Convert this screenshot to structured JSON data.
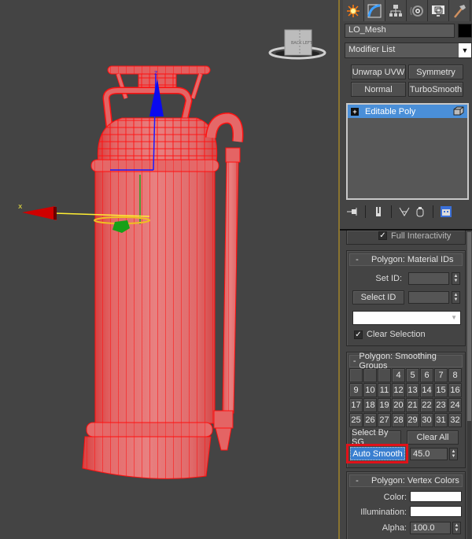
{
  "viewport": {
    "viewcube": {
      "face_front": "BACK",
      "face_side": "LEFT"
    },
    "gizmo": {
      "x_axis_label": "x",
      "z_axis_label": "z"
    },
    "object_color": "#e85050",
    "wire_color": "#ff0000",
    "background_color": "#444444"
  },
  "command_panel": {
    "tabs": [
      {
        "name": "create",
        "icon": "create-icon"
      },
      {
        "name": "modify",
        "icon": "modify-icon",
        "active": true
      },
      {
        "name": "hierarchy",
        "icon": "hierarchy-icon"
      },
      {
        "name": "motion",
        "icon": "motion-icon"
      },
      {
        "name": "display",
        "icon": "display-icon"
      },
      {
        "name": "utilities",
        "icon": "utilities-icon"
      }
    ],
    "object_name": "LO_Mesh",
    "object_color": "#000000",
    "modifier_list": "Modifier List",
    "modifier_buttons": [
      "Unwrap UVW",
      "Symmetry",
      "Normal",
      "TurboSmooth"
    ],
    "stack": [
      {
        "label": "Editable Poly",
        "expand": "+",
        "selected": true
      }
    ],
    "stack_tools": [
      "pin-stack",
      "show-end-result",
      "make-unique",
      "remove-modifier",
      "configure-modifier-sets"
    ],
    "partial_rollout_text": "Full Interactivity",
    "material_ids": {
      "title": "Polygon: Material IDs",
      "collapse": "-",
      "set_id_label": "Set ID:",
      "set_id_value": "",
      "select_id_label": "Select ID",
      "select_id_value": "",
      "name_dropdown_value": "",
      "clear_selection_label": "Clear Selection",
      "clear_selection_checked": true
    },
    "smoothing_groups": {
      "title": "Polygon: Smoothing Groups",
      "collapse": "-",
      "groups": [
        "",
        "",
        "",
        "4",
        "5",
        "6",
        "7",
        "8",
        "9",
        "10",
        "11",
        "12",
        "13",
        "14",
        "15",
        "16",
        "17",
        "18",
        "19",
        "20",
        "21",
        "22",
        "23",
        "24",
        "25",
        "26",
        "27",
        "28",
        "29",
        "30",
        "31",
        "32"
      ],
      "select_by_sg": "Select By SG",
      "clear_all": "Clear All",
      "auto_smooth": "Auto Smooth",
      "auto_smooth_value": "45.0",
      "highlight_color": "#e0121a"
    },
    "vertex_colors": {
      "title": "Polygon: Vertex Colors",
      "collapse": "-",
      "color_label": "Color:",
      "color_value": "#ffffff",
      "illumination_label": "Illumination:",
      "illumination_value": "#ffffff",
      "alpha_label": "Alpha:",
      "alpha_value": "100.0"
    }
  }
}
